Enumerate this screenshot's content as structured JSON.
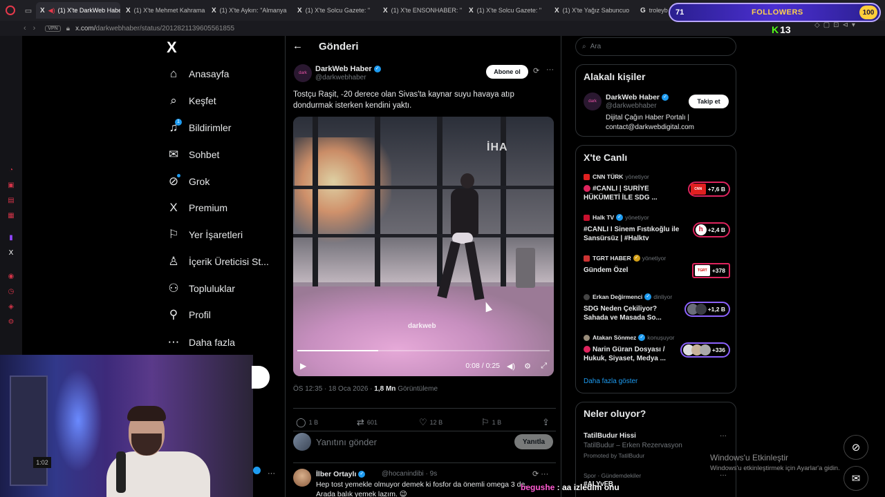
{
  "browser": {
    "tabs": [
      {
        "label": "(1) X'te DarkWeb Habe",
        "active": true
      },
      {
        "label": "(1) X'te Mehmet Kahrama"
      },
      {
        "label": "(1) X'te Aykırı: \"Almanya"
      },
      {
        "label": "(1) X'te Solcu Gazete: \""
      },
      {
        "label": "(1) X'te ENSONHABER: \""
      },
      {
        "label": "(1) X'te Solcu Gazete: \""
      },
      {
        "label": "(1) X'te Yağız Sabuncuo"
      },
      {
        "label": "troleybi"
      }
    ],
    "vpn_label": "VPN",
    "url_host": "x.com/",
    "url_path": "darkwebhaber/status/2012821139605561855"
  },
  "left_nav": {
    "logo": "X",
    "items": [
      {
        "label": "Anasayfa",
        "icon": "home-icon"
      },
      {
        "label": "Keşfet",
        "icon": "search-icon"
      },
      {
        "label": "Bildirimler",
        "icon": "bell-icon",
        "badge": "1"
      },
      {
        "label": "Sohbet",
        "icon": "mail-icon"
      },
      {
        "label": "Grok",
        "icon": "grok-icon"
      },
      {
        "label": "Premium",
        "icon": "x-icon"
      },
      {
        "label": "Yer İşaretleri",
        "icon": "bookmark-icon"
      },
      {
        "label": "İçerik Üreticisi St...",
        "icon": "creator-icon"
      },
      {
        "label": "Topluluklar",
        "icon": "people-icon"
      },
      {
        "label": "Profil",
        "icon": "user-icon"
      },
      {
        "label": "Daha fazla",
        "icon": "more-icon"
      }
    ]
  },
  "post": {
    "header": "Gönderi",
    "author_name": "DarkWeb Haber",
    "author_handle": "@darkwebhaber",
    "avatar_text": "dark",
    "subscribe_label": "Abone ol",
    "text": "Tostçu Raşit, -20 derece olan Sivas'ta kaynar suyu havaya atıp dondurmak isterken kendini yaktı.",
    "video": {
      "watermark": "İHA",
      "watermark2": "darkweb",
      "time": "0:08 / 0:25",
      "progress": 0.32
    },
    "time": "ÖS 12:35 · 18 Oca 2026 · ",
    "views_count": "1,8 Mn",
    "views_label": "Görüntüleme",
    "stats": {
      "replies": "1 B",
      "reposts": "601",
      "likes": "12 B",
      "bookmarks": "1 B"
    },
    "reply_placeholder": "Yanıtını gönder",
    "reply_button": "Yanıtla"
  },
  "reply": {
    "name": "İlber Ortaylı",
    "handle": "@hocanindibi · 9s",
    "text": "Hep tost yemekle olmuyor demek ki fosfor da önemli omega 3 de. Arada balık yemek lazım. 😉"
  },
  "right": {
    "search_placeholder": "Ara",
    "related_title": "Alakalı kişiler",
    "related": {
      "name": "DarkWeb Haber",
      "handle": "@darkwebhaber",
      "bio": "Dijital Çağın Haber Portalı | contact@darkwebdigital.com",
      "follow_label": "Takip et",
      "avatar_text": "dark"
    },
    "live_title": "X'te Canlı",
    "live": [
      {
        "host": "CNN TÜRK",
        "role": "yönetiyor",
        "title": "#CANLI | SURİYE HÜKÜMETİ İLE SDG ...",
        "count": "+7,6 B",
        "logo": "CNN",
        "host_color": "#e02020",
        "pill": "red"
      },
      {
        "host": "Halk TV",
        "role": "yönetiyor",
        "title": "#CANLI I Sinem Fıstıkoğlu ile Sansürsüz | #Halktv",
        "count": "+2,4 B",
        "logo": "h",
        "host_color": "#e02020",
        "pill": "red"
      },
      {
        "host": "TGRT HABER",
        "role": "yönetiyor",
        "title": "Gündem Özel",
        "count": "+378",
        "logo": "TGRT",
        "host_color": "#cc3333",
        "pill": "red"
      },
      {
        "host": "Erkan Değirmenci",
        "role": "dinliyor",
        "title": "SDG Neden Çekiliyor? Sahada ve Masada So...",
        "count": "+1,2 B",
        "logo": "",
        "host_color": "#556",
        "pill": "violet"
      },
      {
        "host": "Atakan Sönmez",
        "role": "konuşuyor",
        "title": "Narin Güran Dosyası / Hukuk, Siyaset, Medya ...",
        "count": "+336",
        "logo": "",
        "host_color": "#998",
        "pill": "violet"
      }
    ],
    "show_more": "Daha fazla göster",
    "trends_title": "Neler oluyor?",
    "trend1": {
      "name": "TatilBudur Hissi",
      "sub": "TatilBudur – Erken Rezervasyon",
      "promo": "Promoted by TatilBudur"
    },
    "trend2": {
      "category": "Spor · Gündemdekiler",
      "tag": "#ALYvFB"
    }
  },
  "overlay": {
    "followers_count": "71",
    "followers_label": "FOLLOWERS",
    "followers_goal": "100",
    "kick_logo": "K",
    "kick_suffix": "13",
    "clock": "1:02",
    "windows_line1": "Windows'u Etkinleştir",
    "windows_line2": "Windows'u etkinleştirmek için Ayarlar'a gidin.",
    "chat_user": "begushe",
    "chat_text": " : aa izledim onu"
  }
}
